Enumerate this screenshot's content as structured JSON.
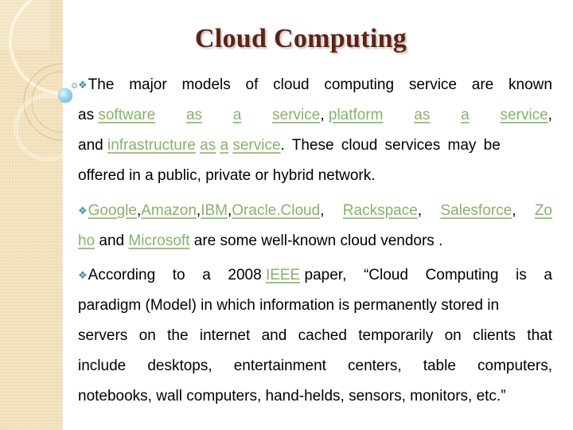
{
  "slide": {
    "title": "Cloud Computing",
    "bullet_icon": "❖",
    "colors": {
      "title": "#5b2316",
      "link": "#86b26a",
      "bullet": "#3f8f9a",
      "panel": "#f1dfb8"
    },
    "p1": {
      "l1": [
        "The",
        "major",
        "models",
        "of",
        "cloud",
        "computing",
        "service",
        "are",
        "known"
      ],
      "l2": {
        "as": "as",
        "software": "software",
        "as1": "as",
        "a1": "a",
        "service1": "service",
        "comma1": ",",
        "platform": "platform",
        "as2": "as",
        "a2": "a",
        "service2": "service",
        "comma2": ","
      },
      "l3": {
        "and": "and",
        "infrastructure": "infrastructure",
        "as": "as",
        "a": "a",
        "service": "service",
        "rest": ". These cloud services may be"
      },
      "l4": "offered in a public, private or hybrid network."
    },
    "p2": {
      "vendors": [
        "Google",
        "Amazon",
        "IBM",
        "Oracle.Cloud",
        "Rackspace",
        "Salesforce",
        "Zo"
      ],
      "l2": {
        "ho": "ho",
        "and": "and",
        "microsoft": "Microsoft",
        "rest": "are some well-known cloud vendors ."
      }
    },
    "p3": {
      "l1": {
        "w1": "According",
        "w2": "to",
        "w3": "a",
        "w4": "2008",
        "ieee": "IEEE",
        "w5": "paper,",
        "w6": "“Cloud",
        "w7": "Computing",
        "w8": "is",
        "w9": "a"
      },
      "l2": "paradigm (Model) in which information is permanently stored in",
      "l3": [
        "servers",
        "on",
        "the",
        "internet",
        "and",
        "cached",
        "temporarily",
        "on",
        "clients",
        "that"
      ],
      "l4": [
        "include",
        "desktops,",
        "entertainment",
        "centers,",
        "table",
        "computers,"
      ],
      "l5": "notebooks, wall computers, hand-helds, sensors, monitors, etc.”"
    }
  }
}
